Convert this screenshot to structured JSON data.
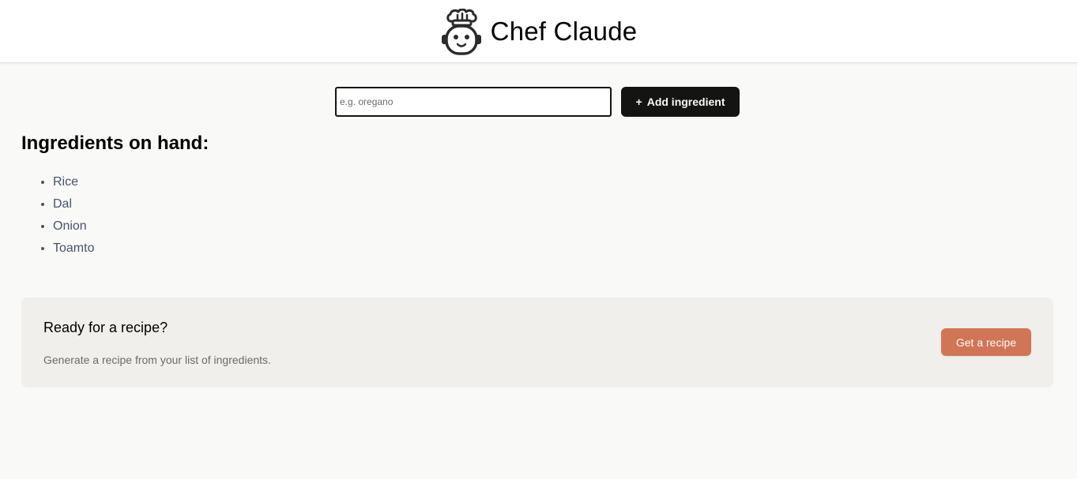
{
  "header": {
    "brand": "Chef Claude",
    "logo_icon": "chef-hat-face-icon"
  },
  "form": {
    "placeholder": "e.g. oregano",
    "value": "",
    "add_icon": "+",
    "add_label": "Add ingredient"
  },
  "ingredients": {
    "title": "Ingredients on hand:",
    "items": [
      "Rice",
      "Dal",
      "Onion",
      "Toamto"
    ]
  },
  "recipe_card": {
    "title": "Ready for a recipe?",
    "description": "Generate a recipe from your list of ingredients.",
    "button_label": "Get a recipe"
  },
  "colors": {
    "page_background": "#f9f9f7",
    "header_background": "#ffffff",
    "dark_button": "#141413",
    "accent_button": "#d17557",
    "card_background": "#f0efeb",
    "list_text": "#475467"
  }
}
